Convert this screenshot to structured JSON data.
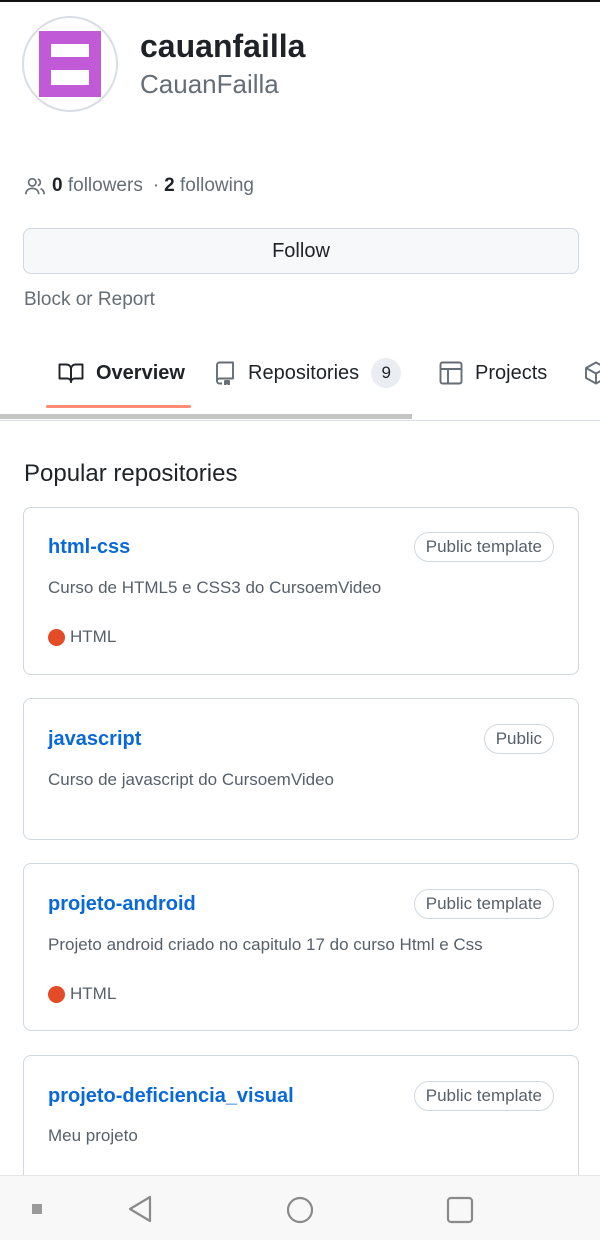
{
  "profile": {
    "fullname": "cauanfailla",
    "username": "CauanFailla"
  },
  "stats": {
    "followers_count": "0",
    "followers_label": "followers",
    "separator": "·",
    "following_count": "2",
    "following_label": "following"
  },
  "actions": {
    "follow_label": "Follow",
    "block_report_label": "Block or Report"
  },
  "tabs": [
    {
      "label": "Overview",
      "icon": "book-icon",
      "selected": true
    },
    {
      "label": "Repositories",
      "icon": "repo-icon",
      "count": "9"
    },
    {
      "label": "Projects",
      "icon": "table-icon"
    },
    {
      "label": "",
      "icon": "package-icon"
    }
  ],
  "popular": {
    "title": "Popular repositories",
    "repos": [
      {
        "name": "html-css",
        "visibility": "Public template",
        "description": "Curso de HTML5 e CSS3 do CursoemVideo",
        "language": "HTML"
      },
      {
        "name": "javascript",
        "visibility": "Public",
        "description": "Curso de javascript do CursoemVideo"
      },
      {
        "name": "projeto-android",
        "visibility": "Public template",
        "description": "Projeto android criado no capitulo 17 do curso Html e Css",
        "language": "HTML"
      },
      {
        "name": "projeto-deficiencia_visual",
        "visibility": "Public template",
        "description": "Meu projeto"
      }
    ]
  },
  "colors": {
    "link": "#0969da",
    "tab_underline": "#fd8c73",
    "html_language": "#e34c26",
    "avatar": "#c05ad6"
  },
  "system_nav": {
    "icons": [
      "menu-square-icon",
      "back-icon",
      "home-icon",
      "recents-icon"
    ]
  }
}
